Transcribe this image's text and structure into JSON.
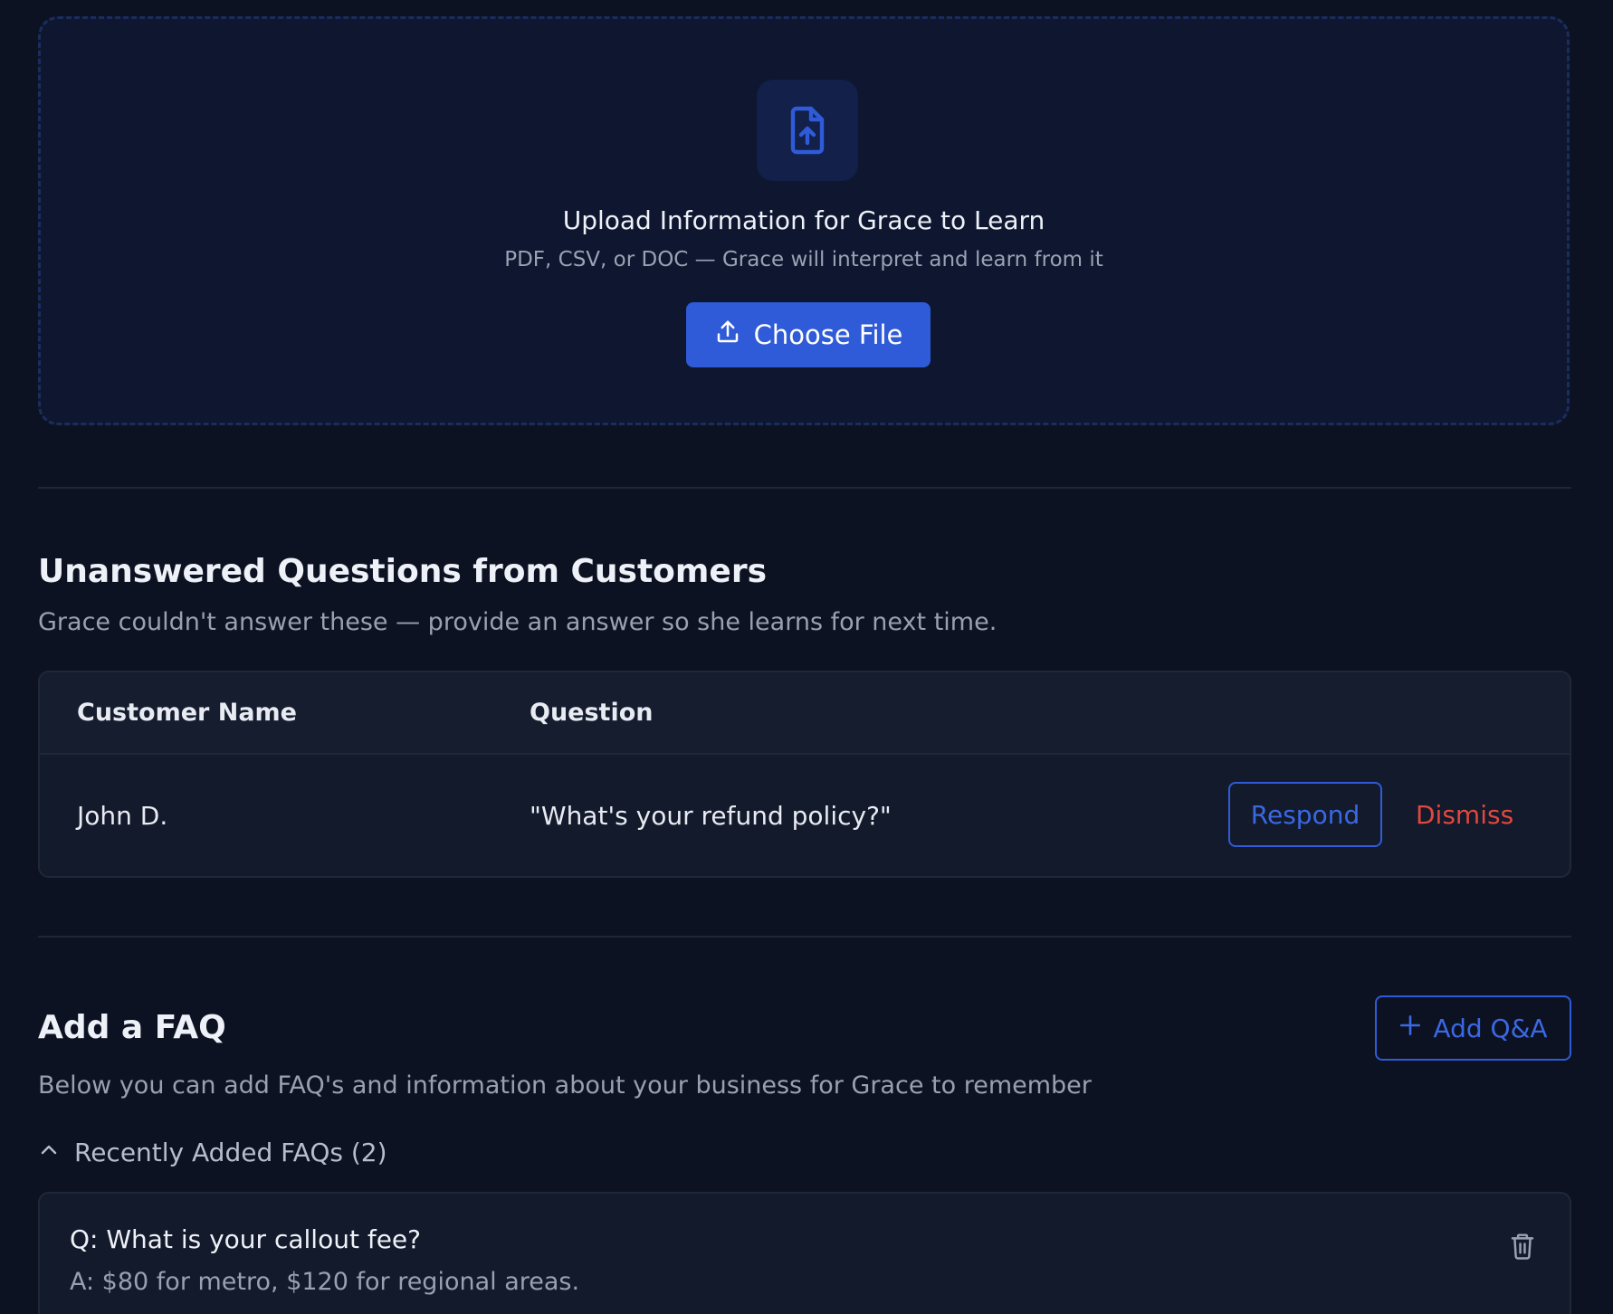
{
  "upload": {
    "icon": "file-upload-icon",
    "title": "Upload Information for Grace to Learn",
    "subtitle": "PDF, CSV, or DOC — Grace will interpret and learn from it",
    "button_label": "Choose File",
    "button_icon": "upload-icon"
  },
  "unanswered": {
    "title": "Unanswered Questions from Customers",
    "subtitle": "Grace couldn't answer these — provide an answer so she learns for next time.",
    "columns": [
      "Customer Name",
      "Question"
    ],
    "rows": [
      {
        "customer": "John D.",
        "question": "\"What's your refund policy?\"",
        "respond_label": "Respond",
        "dismiss_label": "Dismiss"
      }
    ]
  },
  "faq": {
    "title": "Add a FAQ",
    "add_button_label": "Add Q&A",
    "subtitle": "Below you can add FAQ's and information about your business for Grace to remember",
    "recent_label": "Recently Added FAQs (2)",
    "items": [
      {
        "question": "Q: What is your callout fee?",
        "answer": "A: $80 for metro, $120 for regional areas."
      }
    ]
  },
  "colors": {
    "background": "#0c1222",
    "accent": "#2f5bd8",
    "danger": "#e2473e"
  }
}
